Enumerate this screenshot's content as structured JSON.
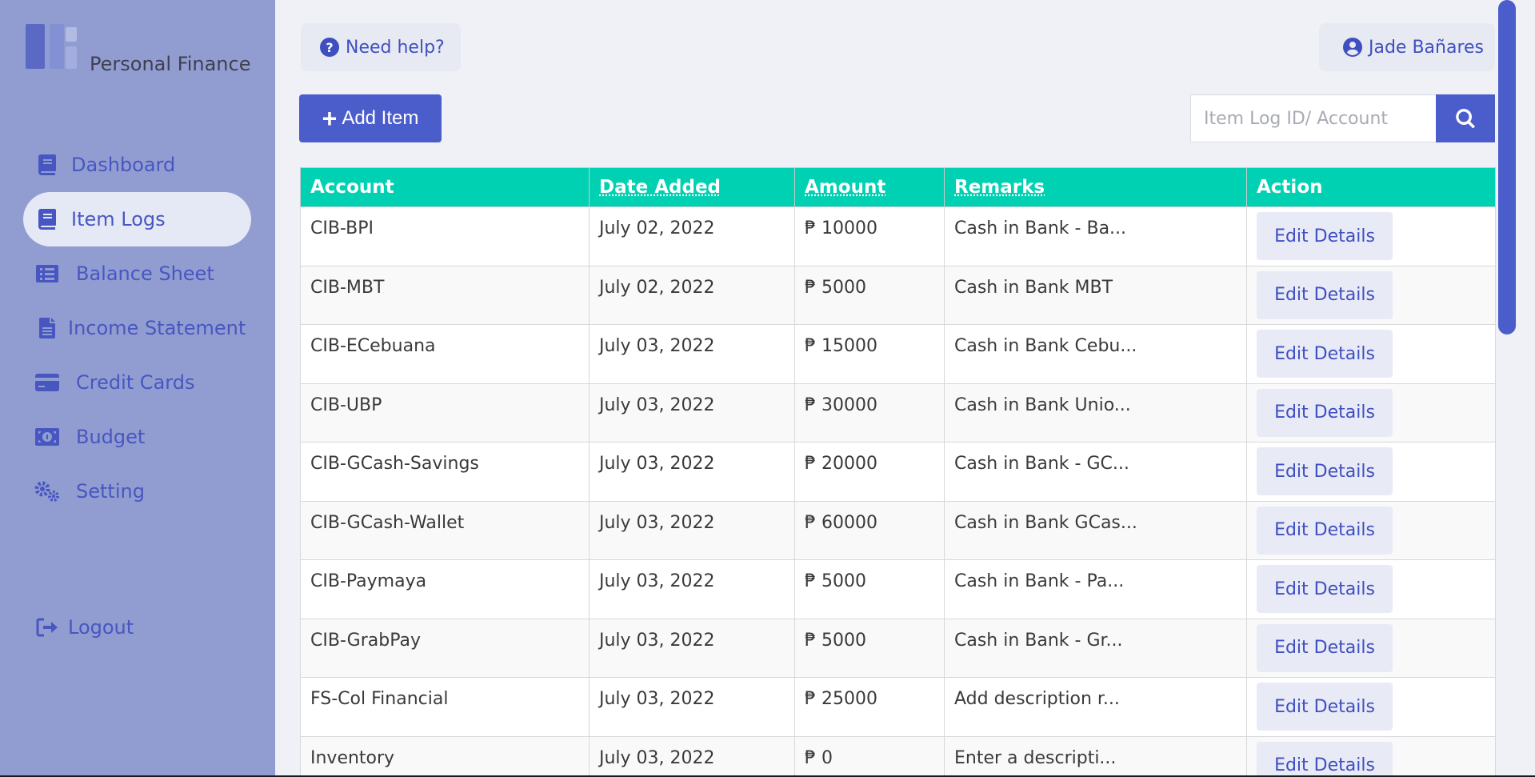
{
  "app": {
    "title": "Personal Finance"
  },
  "sidebar": {
    "items": [
      {
        "label": "Dashboard",
        "icon": "book-icon",
        "active": false
      },
      {
        "label": "Item Logs",
        "icon": "book-icon",
        "active": true
      },
      {
        "label": "Balance Sheet",
        "icon": "list-icon",
        "active": false
      },
      {
        "label": "Income Statement",
        "icon": "file-icon",
        "active": false
      },
      {
        "label": "Credit Cards",
        "icon": "credit-card-icon",
        "active": false
      },
      {
        "label": "Budget",
        "icon": "money-bill-icon",
        "active": false
      },
      {
        "label": "Setting",
        "icon": "cogs-icon",
        "active": false
      }
    ],
    "logout_label": "Logout"
  },
  "header": {
    "help_label": "Need help?",
    "user_name": "Jade Bañares"
  },
  "toolbar": {
    "add_label": "Add Item",
    "search_placeholder": "Item Log ID/ Account"
  },
  "table": {
    "columns": [
      "Account",
      "Date Added",
      "Amount",
      "Remarks",
      "Action"
    ],
    "rows": [
      {
        "account": "CIB-BPI",
        "date": "July 02, 2022",
        "amount": "₱ 10000",
        "remarks": "Cash in Bank - Ba...",
        "action": "Edit Details"
      },
      {
        "account": "CIB-MBT",
        "date": "July 02, 2022",
        "amount": "₱ 5000",
        "remarks": "Cash in Bank MBT",
        "action": "Edit Details"
      },
      {
        "account": "CIB-ECebuana",
        "date": "July 03, 2022",
        "amount": "₱ 15000",
        "remarks": "Cash in Bank Cebu...",
        "action": "Edit Details"
      },
      {
        "account": "CIB-UBP",
        "date": "July 03, 2022",
        "amount": "₱ 30000",
        "remarks": "Cash in Bank Unio...",
        "action": "Edit Details"
      },
      {
        "account": "CIB-GCash-Savings",
        "date": "July 03, 2022",
        "amount": "₱ 20000",
        "remarks": "Cash in Bank - GC...",
        "action": "Edit Details"
      },
      {
        "account": "CIB-GCash-Wallet",
        "date": "July 03, 2022",
        "amount": "₱ 60000",
        "remarks": "Cash in Bank GCas...",
        "action": "Edit Details"
      },
      {
        "account": "CIB-Paymaya",
        "date": "July 03, 2022",
        "amount": "₱ 5000",
        "remarks": "Cash in Bank - Pa...",
        "action": "Edit Details"
      },
      {
        "account": "CIB-GrabPay",
        "date": "July 03, 2022",
        "amount": "₱ 5000",
        "remarks": "Cash in Bank - Gr...",
        "action": "Edit Details"
      },
      {
        "account": "FS-Col Financial",
        "date": "July 03, 2022",
        "amount": "₱ 25000",
        "remarks": "Add description r...",
        "action": "Edit Details"
      },
      {
        "account": "Inventory",
        "date": "July 03, 2022",
        "amount": "₱ 0",
        "remarks": "Enter a descripti...",
        "action": "Edit Details"
      }
    ]
  },
  "colors": {
    "sidebar_bg": "#919dd1",
    "accent": "#4a5dcb",
    "table_header": "#00d1b2"
  }
}
